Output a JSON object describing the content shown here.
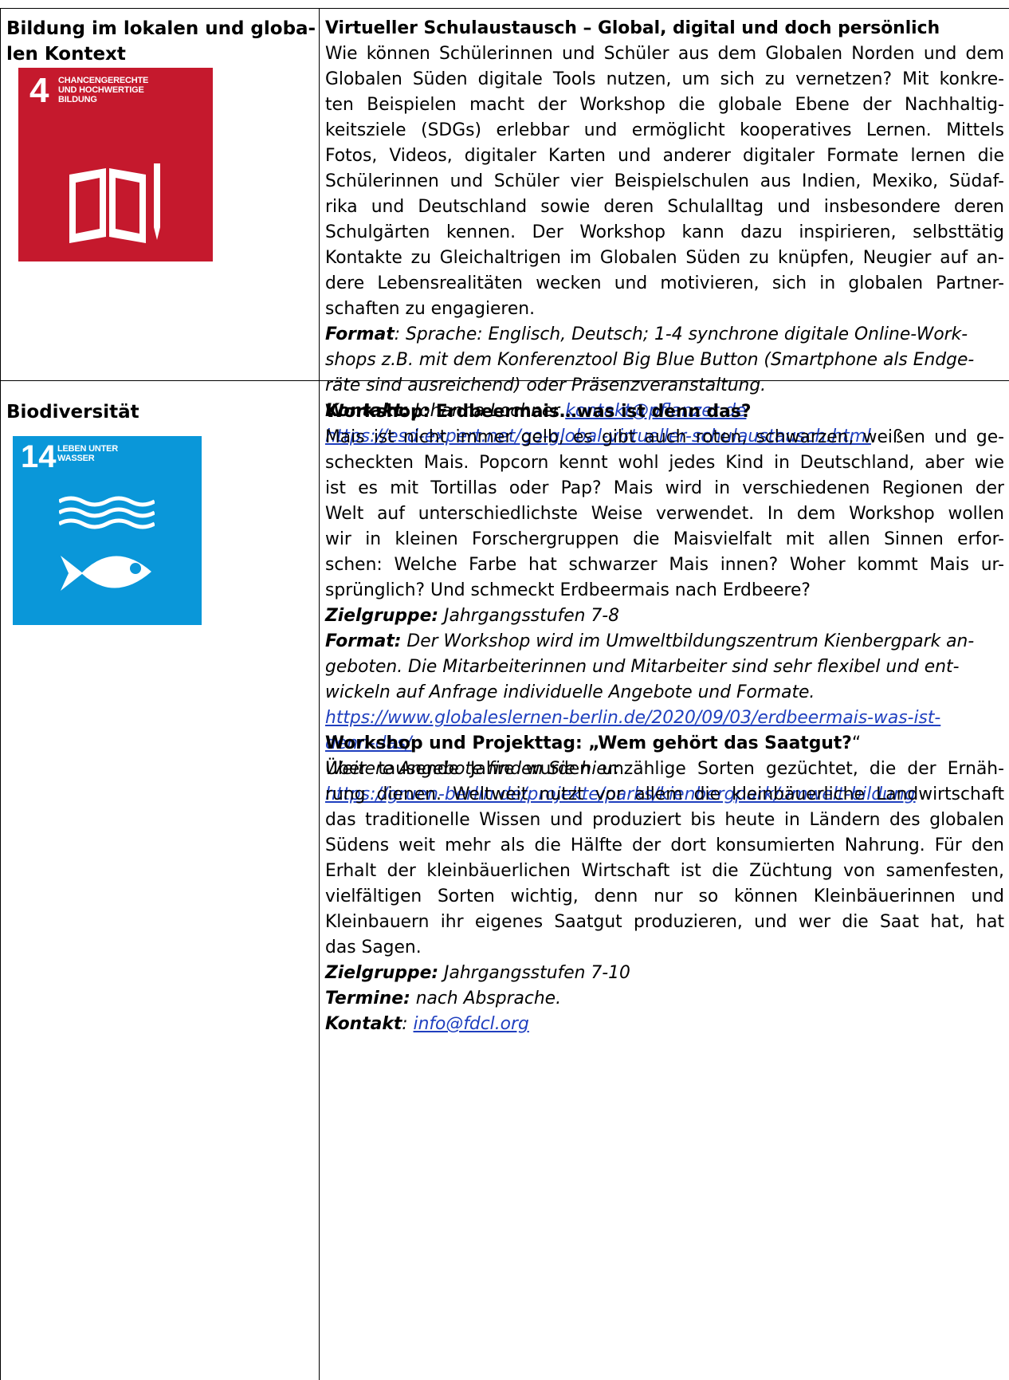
{
  "rows": [
    {
      "category_lines": [
        "Bildung im lokalen und globa-",
        "len Kontext"
      ],
      "sdg": {
        "number": "4",
        "title_lines": [
          "CHANCENGERECHTE",
          "UND HOCHWERTIGE",
          "BILDUNG"
        ],
        "color": "#c5192d",
        "icon": "book-pencil-icon"
      },
      "entries": [
        {
          "title": "Virtueller Schulaustausch – Global, digital und doch persönlich",
          "body_lines": [
            "Wie können Schülerinnen und Schüler aus dem Globalen Norden und dem",
            "Globalen Süden digitale Tools nutzen, um sich zu vernetzen? Mit konkre-",
            "ten Beispielen macht der Workshop die globale Ebene der Nachhaltig-",
            "keitsziele (SDGs) erlebbar und ermöglicht kooperatives Lernen. Mittels",
            "Fotos, Videos, digitaler Karten und anderer digitaler Formate lernen die",
            "Schülerinnen und Schüler vier Beispielschulen aus Indien, Mexiko, Südaf-",
            "rika und Deutschland sowie deren Schulalltag und insbesondere deren",
            "Schulgärten kennen. Der Workshop kann dazu inspirieren, selbsttätig",
            "Kontakte zu Gleichaltrigen im Globalen Süden zu knüpfen, Neugier auf an-",
            "dere Lebensrealitäten wecken und motivieren, sich in globalen Partner-",
            "schaften zu engagieren."
          ],
          "format_label": "Format",
          "format_colon": ": ",
          "format_lines": [
            "Sprache: Englisch, Deutsch; 1-4 synchrone digitale Online-Work-",
            "shops z.B. mit dem Konferenztool Big Blue Button (Smartphone als Endge-",
            "räte sind ausreichend) oder Präsenzveranstaltung."
          ],
          "contact_label": "Kontakt:",
          "contact_name": " Johanna Lochner ",
          "contact_email": "kontakt@pflanzet.de",
          "url": "https://esd-expert.net/go-global-virtueller-schulaustausch.html"
        }
      ]
    },
    {
      "category_lines": [
        "Biodiversität"
      ],
      "sdg": {
        "number": "14",
        "title_lines": [
          "LEBEN UNTER",
          "WASSER"
        ],
        "color": "#0a97d9",
        "icon": "fish-waves-icon"
      },
      "entries": [
        {
          "title": "Workshop: Erdbeermais…was ist denn das?",
          "body_lines": [
            "Mais ist nicht immer gelb, es gibt auch roten, schwarzen, weißen und ge-",
            "scheckten Mais. Popcorn kennt wohl jedes Kind in Deutschland, aber wie",
            "ist es mit Tortillas oder Pap? Mais wird in verschiedenen Regionen der",
            "Welt auf unterschiedlichste Weise verwendet. In dem Workshop wollen",
            "wir in kleinen Forschergruppen die Maisvielfalt mit allen Sinnen erfor-",
            "schen: Welche Farbe hat schwarzer Mais innen? Woher kommt Mais ur-",
            "sprünglich? Und schmeckt Erdbeermais nach Erdbeere?"
          ],
          "target_label": "Zielgruppe:",
          "target_value": " Jahrgangsstufen 7-8",
          "format_label": "Format:",
          "format_lines": [
            " Der Workshop wird im Umweltbildungszentrum Kienbergpark an-",
            "geboten. Die Mitarbeiterinnen und Mitarbeiter sind sehr flexibel und ent-",
            "wickeln auf Anfrage individuelle Angebote und Formate."
          ],
          "url_lines": [
            "https://www.globaleslernen-berlin.de/2020/09/03/erdbeermais-was-ist-",
            "denn-das/"
          ],
          "more_text": "Weitere Angebote finden Sie hier:",
          "more_url": "https://gruen-berlin.de/projekte/parks/kienbergpark/umwelt-bildung"
        },
        {
          "title_main": "Workshop und Projekttag: „Wem gehört das Saatgut?",
          "title_end": "“",
          "body_lines": [
            "Über tausende Jahre wurden unzählige Sorten gezüchtet, die der Ernäh-",
            "rung dienen. Weltweit nutzt vor allem die kleinbäuerliche Landwirtschaft",
            "das traditionelle Wissen und produziert bis heute in Ländern des globalen",
            "Südens weit mehr als die Hälfte der dort konsumierten Nahrung. Für den",
            "Erhalt der kleinbäuerlichen Wirtschaft ist die Züchtung von samenfesten,",
            "vielfältigen Sorten wichtig, denn nur so können Kleinbäuerinnen und",
            "Kleinbauern ihr eigenes Saatgut produzieren, und wer die Saat hat, hat",
            "das Sagen."
          ],
          "target_label": "Zielgruppe:",
          "target_value": " Jahrgangsstufen 7-10",
          "dates_label": "Termine:",
          "dates_value": " nach Absprache.",
          "contact_label": "Kontakt",
          "contact_colon": ": ",
          "contact_email": "info@fdcl.org"
        }
      ]
    }
  ]
}
